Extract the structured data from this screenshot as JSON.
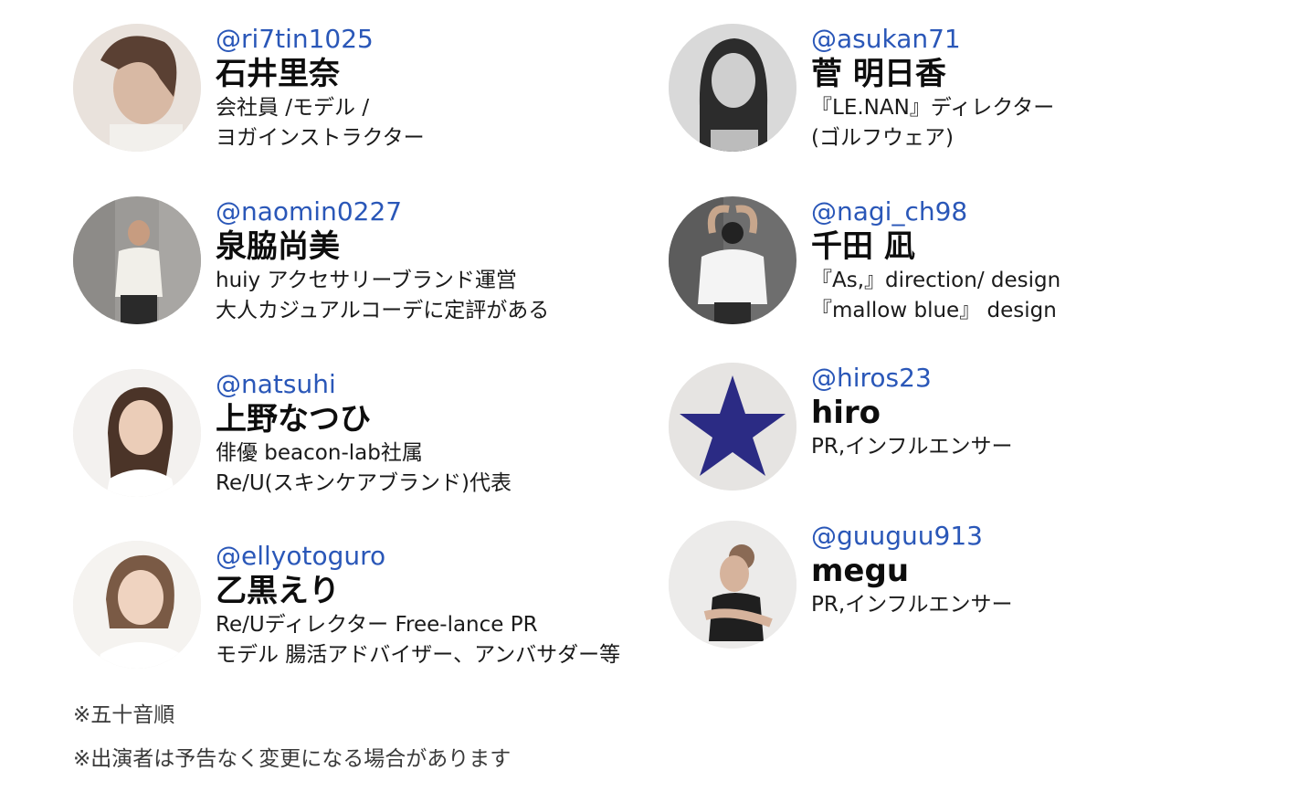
{
  "profiles_left": [
    {
      "handle": "@ri7tin1025",
      "name": "石井里奈",
      "desc_lines": [
        "会社員 /モデル /",
        "ヨガインストラクター"
      ],
      "avatar": "portrait-photo"
    },
    {
      "handle": "@naomin0227",
      "name": "泉脇尚美",
      "desc_lines": [
        "huiy アクセサリーブランド運営",
        "大人カジュアルコーデに定評がある"
      ],
      "avatar": "portrait-photo"
    },
    {
      "handle": "@natsuhi",
      "name": "上野なつひ",
      "desc_lines": [
        "俳優 beacon-lab社属",
        "Re/U(スキンケアブランド)代表"
      ],
      "avatar": "portrait-photo"
    },
    {
      "handle": "@ellyotoguro",
      "name": "乙黒えり",
      "desc_lines": [
        "Re/Uディレクター Free-lance PR",
        "モデル 腸活アドバイザー、アンバサダー等"
      ],
      "avatar": "portrait-photo"
    }
  ],
  "profiles_right": [
    {
      "handle": "@asukan71",
      "name": "菅 明日香",
      "desc_lines": [
        "『LE.NAN』ディレクター",
        "(ゴルフウェア)"
      ],
      "avatar": "portrait-photo-monochrome"
    },
    {
      "handle": "@nagi_ch98",
      "name": "千田 凪",
      "desc_lines": [
        "『As,』direction/ design",
        "『mallow blue』 design"
      ],
      "avatar": "portrait-photo"
    },
    {
      "handle": "@hiros23",
      "name": "hiro",
      "desc_lines": [
        "PR,インフルエンサー"
      ],
      "avatar": "star-icon"
    },
    {
      "handle": "@guuguu913",
      "name": "megu",
      "desc_lines": [
        "PR,インフルエンサー"
      ],
      "avatar": "portrait-photo"
    }
  ],
  "notes": {
    "order": "※五十音順",
    "change": "※出演者は予告なく変更になる場合があります"
  },
  "colors": {
    "handle": "#2a57b8",
    "star": "#2b2b84",
    "text": "#111111"
  }
}
